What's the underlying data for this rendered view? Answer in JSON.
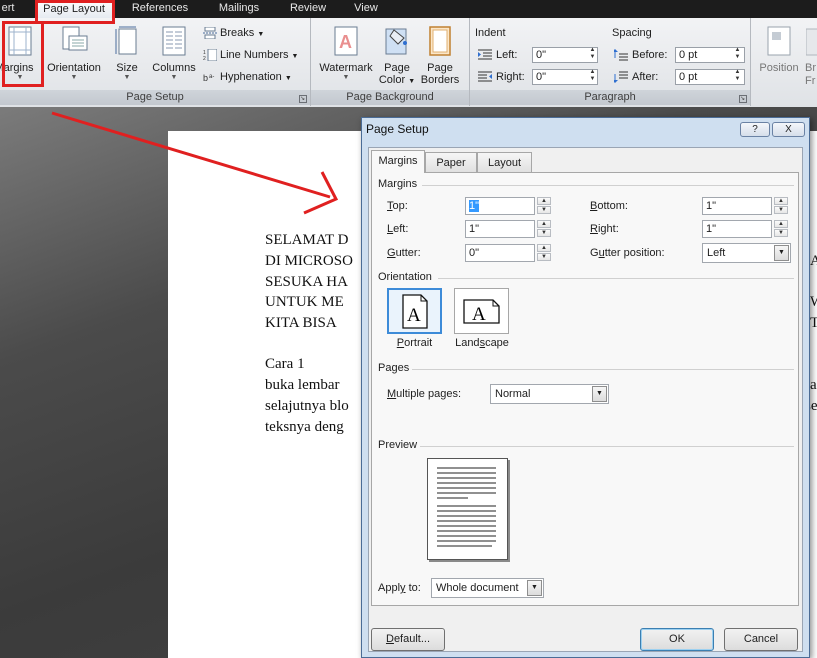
{
  "tabs": [
    "ert",
    "Page Layout",
    "References",
    "Mailings",
    "Review",
    "View"
  ],
  "ribbon": {
    "page_setup": {
      "margins": "Margins",
      "orientation": "Orientation",
      "size": "Size",
      "columns": "Columns",
      "breaks": "Breaks",
      "line_numbers": "Line Numbers",
      "hyphenation": "Hyphenation",
      "label": "Page Setup"
    },
    "page_background": {
      "watermark": "Watermark",
      "page_color_1": "Page",
      "page_color_2": "Color",
      "page_borders_1": "Page",
      "page_borders_2": "Borders",
      "label": "Page Background"
    },
    "paragraph": {
      "indent": "Indent",
      "left": "Left:",
      "left_value": "0\"",
      "right": "Right:",
      "right_value": "0\"",
      "spacing": "Spacing",
      "before": "Before:",
      "before_value": "0 pt",
      "after": "After:",
      "after_value": "0 pt",
      "label": "Paragraph"
    },
    "arrange": {
      "position": "Position",
      "br": "Br",
      "fr": "Fr"
    }
  },
  "document": {
    "lines": [
      "SELAMAT D",
      "DI MICROSO",
      "SESUKA HA",
      "UNTUK ME",
      "KITA BISA"
    ],
    "right_fragments": [
      "AU",
      "",
      "",
      "W",
      "T"
    ],
    "cara": "Cara 1",
    "body": [
      "buka lembar",
      "selajutnya blo",
      "teksnya deng"
    ],
    "body_right": [
      "a",
      "se",
      ""
    ]
  },
  "dialog": {
    "title": "Page Setup",
    "help": "?",
    "close": "X",
    "tabs": [
      "Margins",
      "Paper",
      "Layout"
    ],
    "margins_section": "Margins",
    "top_label_u": "T",
    "top_label": "op:",
    "top_value": "1\"",
    "bottom_label_u": "B",
    "bottom_label": "ottom:",
    "bottom_value": "1\"",
    "left_label_u": "L",
    "left_label": "eft:",
    "left_value": "1\"",
    "right_label_u": "R",
    "right_label": "ight:",
    "right_value": "1\"",
    "gutter_label_u": "G",
    "gutter_label": "utter:",
    "gutter_value": "0\"",
    "gutter_pos_label_1": "G",
    "gutter_pos_label_u": "u",
    "gutter_pos_label_2": "tter position:",
    "gutter_pos_value": "Left",
    "orientation_section": "Orientation",
    "portrait_u": "P",
    "portrait": "ortrait",
    "landscape_u": "s",
    "landscape_1": "Land",
    "landscape_2": "cape",
    "pages_section": "Pages",
    "multiple_pages_u": "M",
    "multiple_pages": "ultiple pages:",
    "multiple_pages_value": "Normal",
    "preview_section": "Preview",
    "apply_to_1": "Appl",
    "apply_to_u": "y",
    "apply_to_2": " to:",
    "apply_to_value": "Whole document",
    "default_u": "D",
    "default": "efault...",
    "ok": "OK",
    "cancel": "Cancel"
  },
  "colors": {
    "annotation": "#e02020",
    "selected_border": "#3d8bd8",
    "dialog_frame": "#cfdff0"
  }
}
